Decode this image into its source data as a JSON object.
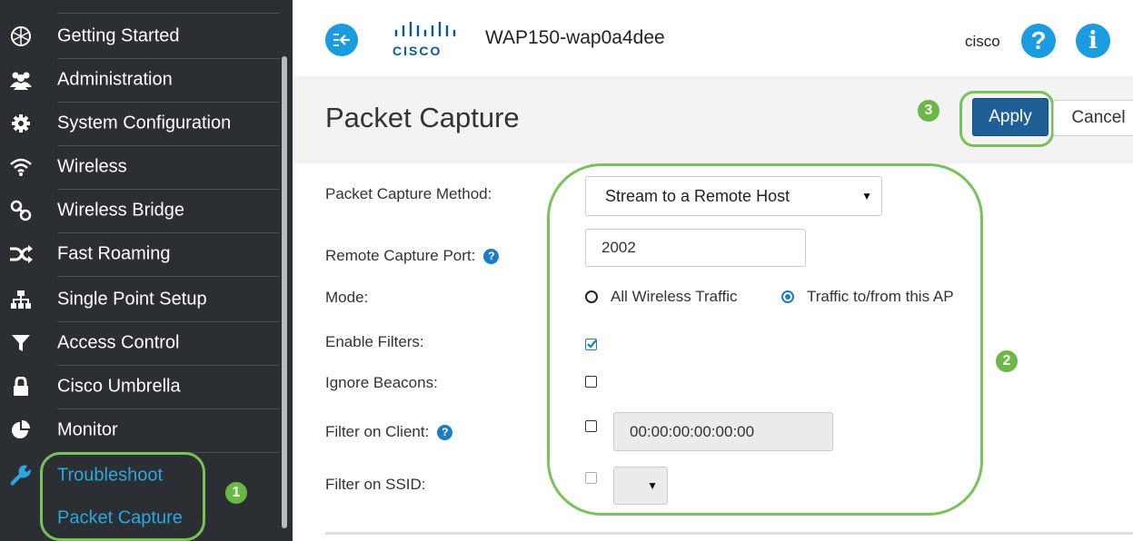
{
  "sidebar": {
    "items": [
      {
        "label": "Getting Started",
        "icon": "globe-icon"
      },
      {
        "label": "Administration",
        "icon": "users-icon"
      },
      {
        "label": "System Configuration",
        "icon": "gear-icon"
      },
      {
        "label": "Wireless",
        "icon": "wifi-icon"
      },
      {
        "label": "Wireless Bridge",
        "icon": "link-icon"
      },
      {
        "label": "Fast Roaming",
        "icon": "shuffle-icon"
      },
      {
        "label": "Single Point Setup",
        "icon": "sitemap-icon"
      },
      {
        "label": "Access Control",
        "icon": "filter-icon"
      },
      {
        "label": "Cisco Umbrella",
        "icon": "lock-icon"
      },
      {
        "label": "Monitor",
        "icon": "pie-chart-icon"
      },
      {
        "label": "Troubleshoot",
        "icon": "wrench-icon"
      }
    ],
    "sub_item": "Packet Capture"
  },
  "header": {
    "logo_word": "CISCO",
    "device_name": "WAP150-wap0a4dee",
    "user": "cisco",
    "help_glyph": "?",
    "info_glyph": "i"
  },
  "page": {
    "title": "Packet Capture",
    "apply_label": "Apply",
    "cancel_label": "Cancel"
  },
  "form": {
    "method_label": "Packet Capture Method:",
    "method_value": "Stream to a Remote Host",
    "port_label": "Remote Capture Port:",
    "port_value": "2002",
    "mode_label": "Mode:",
    "mode_options": [
      "All Wireless Traffic",
      "Traffic to/from this AP"
    ],
    "mode_selected": "Traffic to/from this AP",
    "enable_filters_label": "Enable Filters:",
    "enable_filters_checked": true,
    "ignore_beacons_label": "Ignore Beacons:",
    "ignore_beacons_checked": false,
    "filter_client_label": "Filter on Client:",
    "filter_client_value": "00:00:00:00:00:00",
    "filter_client_checked": false,
    "filter_ssid_label": "Filter on SSID:",
    "filter_ssid_checked": false,
    "help_glyph": "?"
  },
  "annotations": {
    "step1": "1",
    "step2": "2",
    "step3": "3"
  },
  "colors": {
    "sidebar_bg": "#2b2f33",
    "accent_blue": "#1b9be0",
    "link_blue": "#2aa8de",
    "apply_blue": "#1e5f98",
    "annotation_green": "#6ab845"
  }
}
